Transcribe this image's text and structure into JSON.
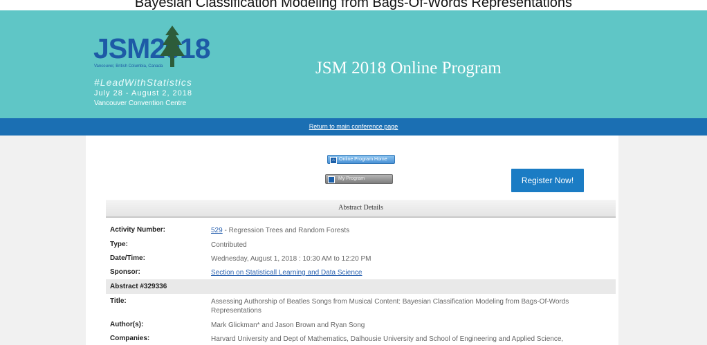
{
  "page_caption": "Bayesian Classification Modeling from Bags-Of-Words Representations",
  "banner": {
    "logo_text": "JSM2018",
    "logo_subtext": "Vancouver, British Columbia, Canada",
    "hashtag": "#LeadWithStatistics",
    "dates": "July 28 - August 2, 2018",
    "venue": "Vancouver Convention Centre",
    "title": "JSM 2018 Online Program",
    "background": "#5fc6c6"
  },
  "navbar": {
    "link": "Return to main conference page",
    "background": "#1b6fb3"
  },
  "buttons": {
    "home": "Online Program Home",
    "my_program": "My Program",
    "register": "Register Now!"
  },
  "abstract": {
    "header": "Abstract Details",
    "rows": [
      {
        "label": "Activity Number:",
        "link": "529",
        "text": " - Regression Trees and Random Forests"
      },
      {
        "label": "Type:",
        "text": "Contributed"
      },
      {
        "label": "Date/Time:",
        "text": "Wednesday, August 1, 2018 : 10:30 AM to 12:20 PM"
      },
      {
        "label": "Sponsor:",
        "link": "Section on Statisticall Learning and Data Science"
      },
      {
        "label": "Abstract #329336"
      },
      {
        "label": "Title:",
        "text": "Assessing Authorship of Beatles Songs from Musical Content: Bayesian Classification Modeling from Bags-Of-Words Representations"
      },
      {
        "label": "Author(s):",
        "text": "Mark Glickman* and Jason Brown and Ryan Song"
      },
      {
        "label": "Companies:",
        "text": "Harvard University and Dept of Mathematics, Dalhousie University and School of Engineering and Applied Science,"
      }
    ]
  }
}
